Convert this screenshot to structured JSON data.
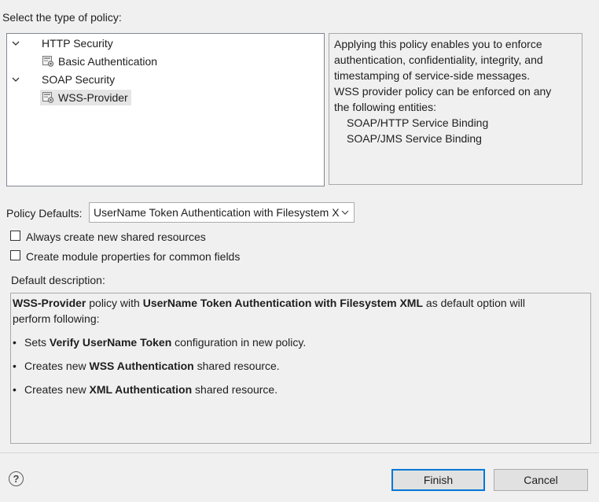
{
  "title": "Select the type of policy:",
  "tree": [
    {
      "label": "HTTP Security",
      "icon": "chevron-down-icon",
      "level": 0,
      "expanded": true
    },
    {
      "label": "Basic Authentication",
      "icon": "policy-icon",
      "level": 1
    },
    {
      "label": "SOAP Security",
      "icon": "chevron-down-icon",
      "level": 0,
      "expanded": true
    },
    {
      "label": "WSS-Provider",
      "icon": "policy-icon",
      "level": 1,
      "selected": true
    }
  ],
  "info": {
    "lines": [
      "Applying this policy enables you to enforce",
      "authentication, confidentiality, integrity, and",
      "timestamping of service-side messages.",
      "WSS provider policy can be enforced on any",
      "the following entities:"
    ],
    "entities": [
      "SOAP/HTTP Service Binding",
      "SOAP/JMS Service Binding"
    ]
  },
  "policy_defaults": {
    "label": "Policy Defaults:",
    "value": "UserName Token Authentication with Filesystem XML"
  },
  "checkboxes": [
    {
      "label": "Always create new shared resources",
      "checked": false
    },
    {
      "label": "Create module properties for common fields",
      "checked": false
    }
  ],
  "default_description": {
    "label": "Default description:",
    "intro_bold1": "WSS-Provider",
    "intro_text1": " policy with ",
    "intro_bold2": "UserName Token Authentication with Filesystem XML",
    "intro_text2": " as default option will",
    "intro_line2": "perform following:",
    "bullets": [
      {
        "pre": "Sets ",
        "bold": "Verify UserName Token",
        "post": " configuration in new policy."
      },
      {
        "pre": "Creates new ",
        "bold": "WSS Authentication",
        "post": " shared resource."
      },
      {
        "pre": "Creates new ",
        "bold": "XML Authentication",
        "post": " shared resource."
      }
    ]
  },
  "buttons": {
    "help": "?",
    "finish": "Finish",
    "cancel": "Cancel"
  }
}
